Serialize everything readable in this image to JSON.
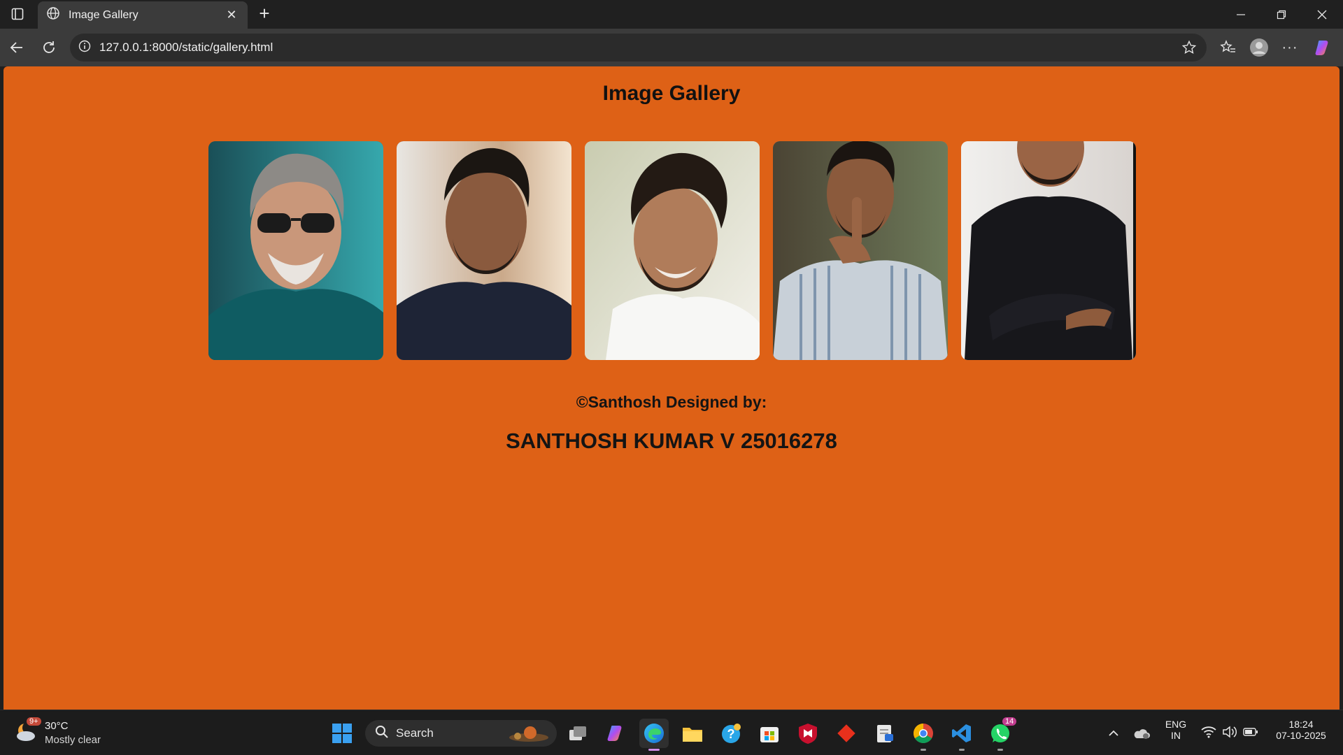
{
  "browser": {
    "tab_title": "Image Gallery",
    "url": "127.0.0.1:8000/static/gallery.html"
  },
  "page": {
    "title": "Image Gallery",
    "credit": "©Santhosh Designed by:",
    "author": "SANTHOSH KUMAR V 25016278",
    "background_color": "#de6116",
    "images": [
      {
        "subject": "man-with-sunglasses-teal-shirt",
        "bg": "#1f6b6f"
      },
      {
        "subject": "bearded-man-dark-shirt",
        "bg": "#2a2f44"
      },
      {
        "subject": "smiling-man-white-shirt",
        "bg": "#e9e7df"
      },
      {
        "subject": "man-finger-on-lips-striped-shirt",
        "bg": "#7c8996"
      },
      {
        "subject": "man-arms-crossed-black-tshirt",
        "bg": "#e8e6e3"
      }
    ]
  },
  "taskbar": {
    "weather_temp": "30°C",
    "weather_condition": "Mostly clear",
    "weather_badge": "9+",
    "search_label": "Search",
    "whatsapp_badge": "14",
    "language_line1": "ENG",
    "language_line2": "IN",
    "time": "18:24",
    "date": "07-10-2025"
  }
}
